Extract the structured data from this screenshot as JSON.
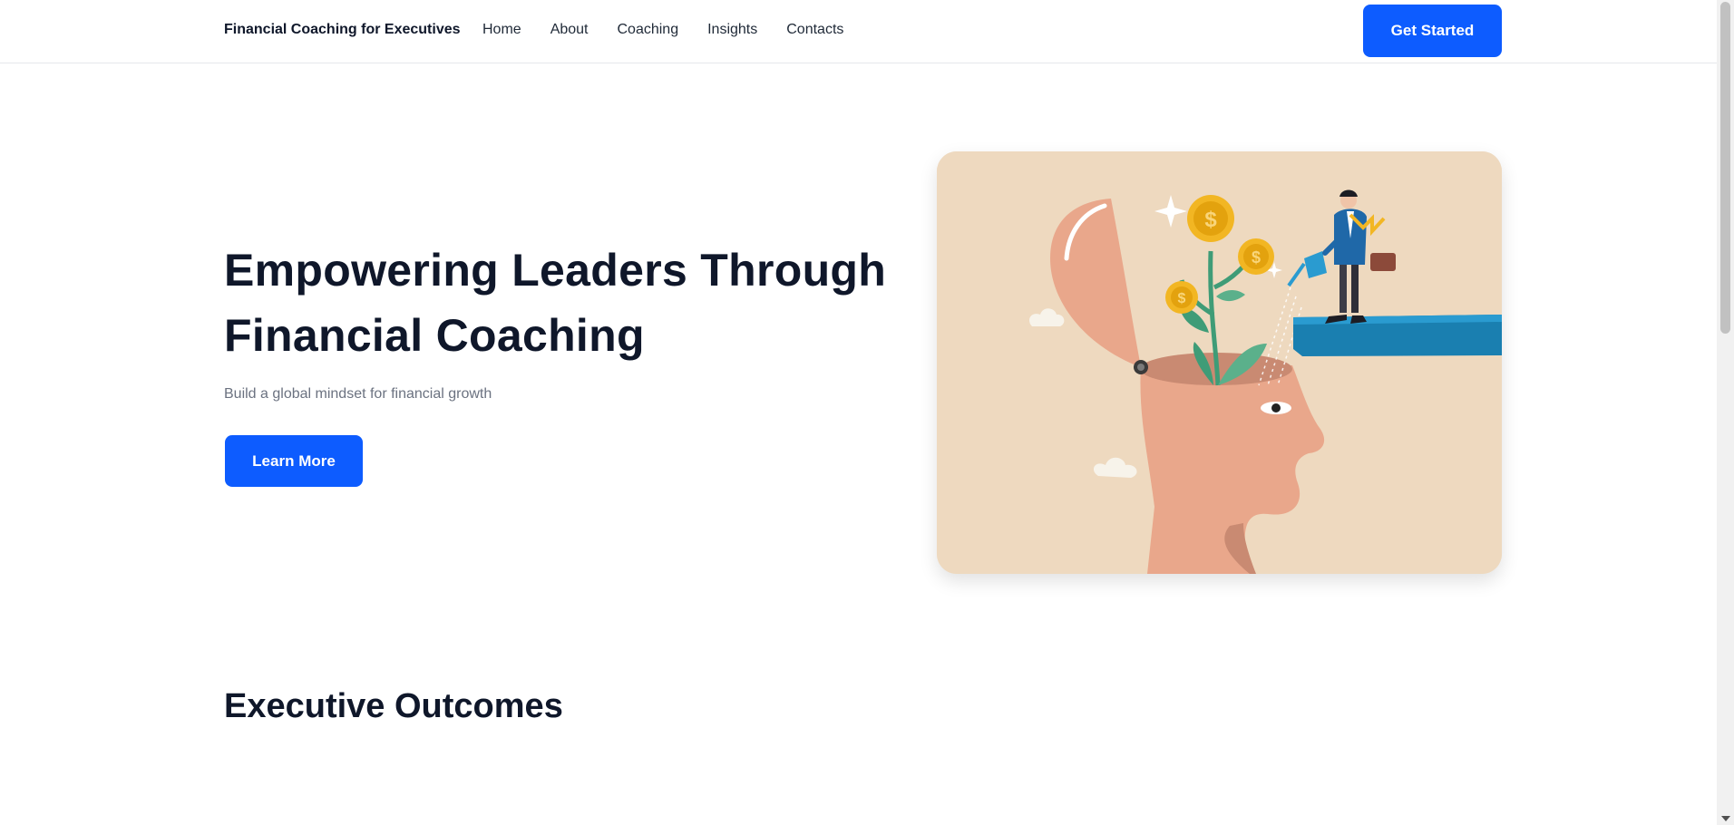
{
  "header": {
    "brand": "Financial Coaching for Executives",
    "nav": [
      "Home",
      "About",
      "Coaching",
      "Insights",
      "Contacts"
    ],
    "cta_label": "Get Started"
  },
  "hero": {
    "title": "Empowering Leaders Through Financial Coaching",
    "subtitle": "Build a global mindset for financial growth",
    "cta_label": "Learn More",
    "image_icon": "head-growth-illustration"
  },
  "sections": {
    "outcomes_title": "Executive Outcomes"
  },
  "colors": {
    "accent": "#0d5cff",
    "heading": "#0f172a",
    "muted": "#6b7280",
    "illustration_bg": "#eed9bf"
  }
}
